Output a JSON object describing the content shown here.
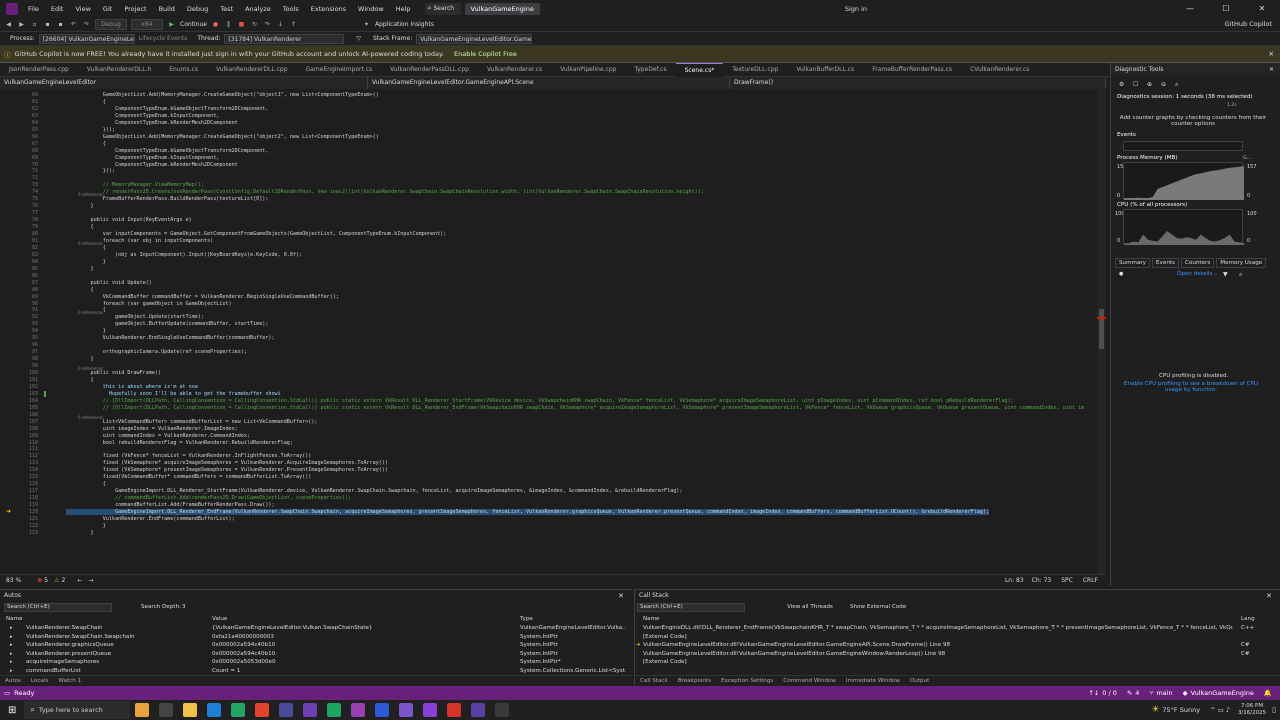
{
  "menu": [
    "File",
    "Edit",
    "View",
    "Git",
    "Project",
    "Build",
    "Debug",
    "Test",
    "Analyze",
    "Tools",
    "Extensions",
    "Window",
    "Help"
  ],
  "search_label": "Search",
  "app_name": "VulkanGameEngine",
  "sign_in": "Sign in",
  "copilot": "GitHub Copilot",
  "toolbar": {
    "config": "Debug",
    "platform": "x64",
    "continue": "Continue",
    "app_insights": "Application Insights"
  },
  "debugbar": {
    "process_label": "Process:",
    "process": "[26604] VulkanGameEngineLevelE",
    "lifecycle": "Lifecycle Events",
    "thread_label": "Thread:",
    "thread": "[31784] VulkanRenderer",
    "stackframe_label": "Stack Frame:",
    "stackframe": "VulkanGameEngineLevelEditor.GameEngi"
  },
  "infobar": {
    "text": "GitHub Copilot is now FREE! You already have it installed just sign in with your GitHub account and unlock AI-powered coding today.",
    "link": "Enable Copilot Free"
  },
  "tabs": [
    "JsonRenderPass.cpp",
    "VulkanRendererDLL.h",
    "Enums.cs",
    "VulkanRendererDLL.cpp",
    "GameEngineImport.cs",
    "VulkanRenderPassDLL.cpp",
    "VulkanRenderer.cs",
    "VulkanPipeline.cpp",
    "TypeDef.cs",
    "Scene.cs*",
    "TextureDLL.cpp",
    "VulkanBufferDLL.cs",
    "FrameBufferRenderPass.cs",
    "CVulkanRenderer.cs"
  ],
  "active_tab": "Scene.cs*",
  "navbar": {
    "project": "VulkanGameEngineLevelEditor",
    "class": "VulkanGameEngineLevelEditor.GameEngineAPI.Scene",
    "member": "DrawFrame()"
  },
  "code": [
    {
      "n": "60",
      "t": "            GameObjectList.Add(MemoryManager.CreateGameObject(\"object1\", new List<ComponentTypeEnum>()"
    },
    {
      "n": "61",
      "t": "            {"
    },
    {
      "n": "62",
      "t": "                ComponentTypeEnum.kGameObjectTransform2DComponent,"
    },
    {
      "n": "63",
      "t": "                ComponentTypeEnum.kInputComponent,"
    },
    {
      "n": "64",
      "t": "                ComponentTypeEnum.kRenderMesh2DComponent"
    },
    {
      "n": "65",
      "t": "            }));"
    },
    {
      "n": "66",
      "t": "            GameObjectList.Add(MemoryManager.CreateGameObject(\"object2\", new List<ComponentTypeEnum>()"
    },
    {
      "n": "67",
      "t": "            {"
    },
    {
      "n": "68",
      "t": "                ComponentTypeEnum.kGameObjectTransform2DComponent,"
    },
    {
      "n": "69",
      "t": "                ComponentTypeEnum.kInputComponent,"
    },
    {
      "n": "70",
      "t": "                ComponentTypeEnum.kRenderMesh2DComponent"
    },
    {
      "n": "71",
      "t": "            }));"
    },
    {
      "n": "72",
      "t": ""
    },
    {
      "n": "73",
      "t": "            // MemoryManager.ViewMemoryMap();"
    },
    {
      "n": "74",
      "t": "            // renderPass2D.CreateJsonRenderPass(ConstConfig.Default2DRenderPass, new ivec2((int)VulkanRenderer.SwapChain.SwapChainResolution.width, (int)VulkanRenderer.SwapChain.SwapChainResolution.height));"
    },
    {
      "n": "75",
      "t": "            FrameBufferRenderPass.BuildRenderPass(textureList[0]);"
    },
    {
      "n": "76",
      "t": "        }"
    },
    {
      "n": "77",
      "t": ""
    },
    {
      "n": "78",
      "t": "        public void Input(KeyEventArgs e)"
    },
    {
      "n": "79",
      "t": "        {"
    },
    {
      "n": "80",
      "t": "            var inputComponents = GameObject.GetComponentFromGameObjects(GameObjectList, ComponentTypeEnum.kInputComponent);"
    },
    {
      "n": "81",
      "t": "            foreach (var obj in inputComponents)"
    },
    {
      "n": "82",
      "t": "            {"
    },
    {
      "n": "83",
      "t": "                (obj as InputComponent).Input((KeyBoardKeys)e.KeyCode, 0.0f);"
    },
    {
      "n": "84",
      "t": "            }"
    },
    {
      "n": "85",
      "t": "        }"
    },
    {
      "n": "86",
      "t": ""
    },
    {
      "n": "87",
      "t": "        public void Update()"
    },
    {
      "n": "88",
      "t": "        {"
    },
    {
      "n": "89",
      "t": "            VkCommandBuffer commandBuffer = VulkanRenderer.BeginSingleUseCommandBuffer();"
    },
    {
      "n": "90",
      "t": "            foreach (var gameObject in GameObjectList)"
    },
    {
      "n": "91",
      "t": "            {"
    },
    {
      "n": "92",
      "t": "                gameObject.Update(startTime);"
    },
    {
      "n": "93",
      "t": "                gameObject.BufferUpdate(commandBuffer, startTime);"
    },
    {
      "n": "94",
      "t": "            }"
    },
    {
      "n": "95",
      "t": "            VulkanRenderer.EndSingleUseCommandBuffer(commandBuffer);"
    },
    {
      "n": "96",
      "t": ""
    },
    {
      "n": "97",
      "t": "            orthographicCamera.Update(ref sceneProperties);"
    },
    {
      "n": "98",
      "t": "        }"
    },
    {
      "n": "99",
      "t": ""
    },
    {
      "n": "100",
      "t": "        public void DrawFrame()"
    },
    {
      "n": "101",
      "t": "        {"
    },
    {
      "n": "102",
      "t": "            this is about where is'm at now"
    },
    {
      "n": "103",
      "t": "              Hopefully soon I'll be able to get the framebuffer showi"
    },
    {
      "n": "104",
      "t": "            // [DllImport(DLLPath, CallingConvention = CallingConvention.StdCall)] public static extern VkResult DLL_Renderer_StartFrame(VkDevice device, VkSwapchainKHR swapChain, VkFence* fenceList, VkSemaphore* acquireImageSemaphoreList, uint pImageIndex, uint pCommandIndex, ref bool pRebuildRendererFlag);"
    },
    {
      "n": "105",
      "t": "            // [DllImport(DLLPath, CallingConvention = CallingConvention.StdCall)] public static extern VkResult DLL_Renderer_EndFrame(VkSwapchainKHR swapChain, VkSemaphore* acquireImageSemaphoreList, VkSemaphore* presentImageSemaphoreList, VkFence* fenceList, VkQueue graphicsQueue, VkQueue presentQueue, uint commandIndex, uint im"
    },
    {
      "n": "106",
      "t": ""
    },
    {
      "n": "107",
      "t": "            List<VkCommandBuffer> commandBufferList = new List<VkCommandBuffer>();"
    },
    {
      "n": "108",
      "t": "            uint imageIndex = VulkanRenderer.ImageIndex;"
    },
    {
      "n": "109",
      "t": "            uint commandIndex = VulkanRenderer.CommandIndex;"
    },
    {
      "n": "110",
      "t": "            bool rebuildRendererFlag = VulkanRenderer.RebuildRendererFlag;"
    },
    {
      "n": "111",
      "t": ""
    },
    {
      "n": "112",
      "t": "            fixed (VkFence* fenceList = VulkanRenderer.InFlightFences.ToArray())"
    },
    {
      "n": "113",
      "t": "            fixed (VkSemaphore* acquireImageSemaphores = VulkanRenderer.AcquireImageSemaphores.ToArray())"
    },
    {
      "n": "114",
      "t": "            fixed (VkSemaphore* presentImageSemaphores = VulkanRenderer.PresentImageSemaphores.ToArray())"
    },
    {
      "n": "115",
      "t": "            fixed(VkCommandBuffer* commandBuffers = commandBufferList.ToArray())"
    },
    {
      "n": "116",
      "t": "            {"
    },
    {
      "n": "117",
      "t": "                GameEngineImport.DLL_Renderer_StartFrame(VulkanRenderer.device, VulkanRenderer.SwapChain.Swapchain, fenceList, acquireImageSemaphores, &imageIndex, &commandIndex, &rebuildRendererFlag);"
    },
    {
      "n": "118",
      "t": "                // commandBufferList.Add(renderPass2D.Draw(GameObjectList, sceneProperties));"
    },
    {
      "n": "119",
      "t": "                commandBufferList.Add(FrameBufferRenderPass.Draw());"
    },
    {
      "n": "120",
      "t": "                GameEngineImport.DLL_Renderer_EndFrame(VulkanRenderer.SwapChain.Swapchain, acquireImageSemaphores, presentImageSemaphores, fenceList, VulkanRenderer.graphicsQueue, VulkanRenderer.presentQueue, commandIndex, imageIndex, commandBuffers, commandBufferList.UCount(), &rebuildRendererFlag);"
    },
    {
      "n": "121",
      "t": "            VulkanRenderer.EndFrame(commandBufferList);"
    },
    {
      "n": "122",
      "t": "            }"
    },
    {
      "n": "123",
      "t": "        }"
    }
  ],
  "refs": "0 references",
  "editor_status": {
    "zoom": "83 %",
    "errors": "5",
    "warnings": "2",
    "ln": "Ln: 83",
    "ch": "Ch: 73",
    "spc": "SPC",
    "crlf": "CRLF"
  },
  "diag": {
    "title": "Diagnostic Tools",
    "session": "Diagnostics session: 1 seconds (38 ms selected)",
    "session_time": "1.2s",
    "add": "Add counter graphs by checking counters from their counter options",
    "events": "Events",
    "mem": "Process Memory (MB)",
    "mem_legend": "G...",
    "mem_max": "157",
    "mem_min": "0",
    "cpu": "CPU (% of all processors)",
    "cpu_max": "100",
    "cpu_min": "0",
    "tabs": [
      "Summary",
      "Events",
      "Counters",
      "Memory Usage"
    ],
    "open_details": "Open details...",
    "cpu_disabled": "CPU profiling is disabled.",
    "cpu_enable": "Enable CPU profiling to see a breakdown of CPU usage by function.",
    "mem_values": [
      0.05,
      0.05,
      0.05,
      0.06,
      0.05,
      0.05,
      0.08,
      0.3,
      0.35,
      0.4,
      0.45,
      0.5,
      0.55,
      0.6,
      0.65,
      0.7,
      0.72,
      0.75,
      0.78,
      0.8,
      0.82,
      0.85,
      0.87,
      0.88,
      0.9,
      0.92
    ],
    "cpu_values": [
      0.02,
      0.05,
      0.1,
      0.08,
      0.3,
      0.15,
      0.12,
      0.1,
      0.25,
      0.4,
      0.3,
      0.2,
      0.18,
      0.22,
      0.2,
      0.15,
      0.3,
      0.2,
      0.12,
      0.1,
      0.14,
      0.2,
      0.3,
      0.1,
      0.08,
      0.05
    ]
  },
  "autos": {
    "title": "Autos",
    "search": "Search (Ctrl+E)",
    "depth_label": "Search Depth:",
    "depth": "3",
    "cols": [
      "Name",
      "Value",
      "Type"
    ],
    "rows": [
      {
        "name": "VulkanRenderer.SwapChain",
        "value": "{VulkanGameEngineLevelEditor.Vulkan.SwapChainState}",
        "type": "VulkanGameEngineLevelEditor.Vulka..."
      },
      {
        "name": "VulkanRenderer.SwapChain.Swapchain",
        "value": "0xfa21a40000000003",
        "type": "System.IntPtr"
      },
      {
        "name": "VulkanRenderer.graphicsQueue",
        "value": "0x000002a594c40b10",
        "type": "System.IntPtr"
      },
      {
        "name": "VulkanRenderer.presentQueue",
        "value": "0x000002a594c40b10",
        "type": "System.IntPtr"
      },
      {
        "name": "acquireImageSemaphores",
        "value": "0x000002a5053d00e0",
        "type": "System.IntPtr*"
      },
      {
        "name": "commandBufferList",
        "value": "Count = 1",
        "type": "System.Collections.Generic.List<Syst..."
      }
    ],
    "tabs": [
      "Autos",
      "Locals",
      "Watch 1"
    ]
  },
  "callstack": {
    "title": "Call Stack",
    "search": "Search (Ctrl+E)",
    "view_threads": "View all Threads",
    "show_external": "Show External Code",
    "cols": [
      "Name",
      "Lang"
    ],
    "rows": [
      {
        "name": "VulkanEngineDLL.dll!DLL_Renderer_EndFrame(VkSwapchainKHR_T * swapChain, VkSemaphore_T * * acquireImageSemaphoreList, VkSemaphore_T * * presentImageSemaphoreList, VkFence_T * * fenceList, VkQueue_T * graphic...",
        "lang": "C++"
      },
      {
        "name": "[External Code]",
        "lang": ""
      },
      {
        "name": "VulkanGameEngineLevelEditor.dll!VulkanGameEngineLevelEditor.GameEngineAPI.Scene.DrawFrame() Line 98",
        "lang": "C#"
      },
      {
        "name": "VulkanGameEngineLevelEditor.dll!VulkanGameEngineLevelEditor.GameEngineWindow.RenderLoop() Line 98",
        "lang": "C#"
      },
      {
        "name": "[External Code]",
        "lang": ""
      }
    ],
    "tabs": [
      "Call Stack",
      "Breakpoints",
      "Exception Settings",
      "Command Window",
      "Immediate Window",
      "Output"
    ]
  },
  "status": {
    "ready": "Ready",
    "updown": "0 / 0",
    "pencil": "4",
    "branch": "main",
    "repo": "VulkanGameEngine"
  },
  "taskbar": {
    "search": "Type here to search",
    "weather": "75°F  Sunny",
    "time": "7:06 PM",
    "date": "3/16/2025"
  },
  "colors": {
    "accent": "#68217a",
    "active_tab_border": "#9d7cd8",
    "infobar": "#3c3720"
  }
}
